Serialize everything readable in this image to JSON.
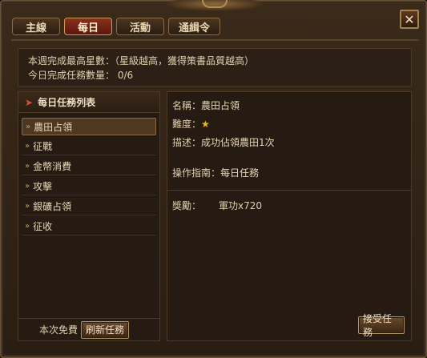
{
  "tabs": [
    {
      "label": "主線",
      "active": false
    },
    {
      "label": "每日",
      "active": true
    },
    {
      "label": "活動",
      "active": false
    },
    {
      "label": "通緝令",
      "active": false
    }
  ],
  "close_label": "✕",
  "info": {
    "line1": "本週完成最高星數：（星級越高，獲得策書品質越高）",
    "line2": "今日完成任務數量： 0/6"
  },
  "task_list": {
    "title": "每日任務列表",
    "items": [
      "農田占領",
      "征戰",
      "金幣消費",
      "攻擊",
      "銀礦占領",
      "征收"
    ],
    "selected_index": 0
  },
  "footer": {
    "free_label": "本次免費",
    "refresh_label": "刷新任務"
  },
  "detail": {
    "name_label": "名稱：",
    "name_value": "農田占領",
    "difficulty_label": "難度：",
    "difficulty_stars": 1,
    "desc_label": "描述：",
    "desc_value": "成功佔領農田1次",
    "guide_label": "操作指南：",
    "guide_value": "每日任務",
    "reward_label": "獎勵：",
    "reward_value": "軍功x720",
    "accept_label": "接受任務"
  },
  "colors": {
    "active_tab": "#8a2f1c",
    "star": "#e8b820",
    "accent_arrow": "#d0552c"
  }
}
